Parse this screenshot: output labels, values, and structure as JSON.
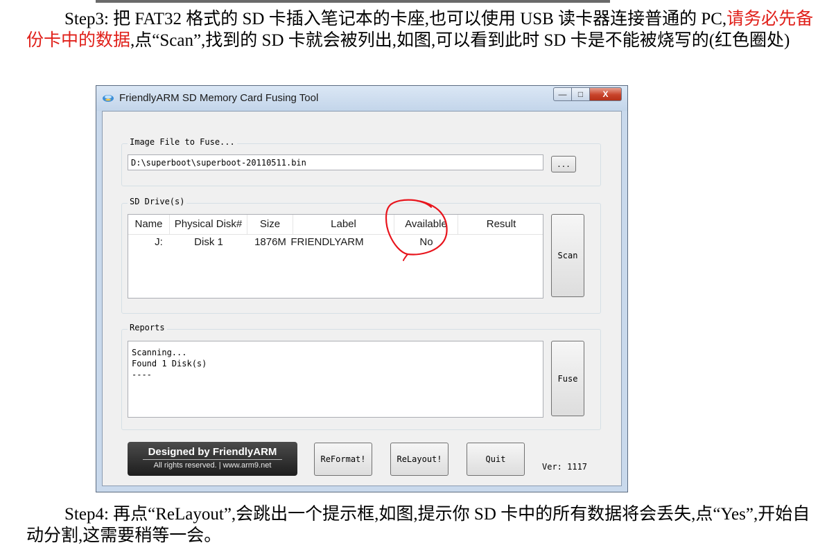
{
  "doc": {
    "step3_prefix": "Step3: 把 FAT32 格式的 SD 卡插入笔记本的卡座,也可以使用 USB 读卡器连接普通的 PC,",
    "step3_warning": "请务必先备份卡中的数据",
    "step3_suffix": ",点“Scan”,找到的 SD 卡就会被列出,如图,可以看到此时 SD 卡是不能被烧写的(红色圈处)",
    "step4": "Step4: 再点“ReLayout”,会跳出一个提示框,如图,提示你 SD 卡中的所有数据将会丢失,点“Yes”,开始自动分割,这需要稍等一会。",
    "warning_color": "#e0201a"
  },
  "window": {
    "title": "FriendlyARM SD Memory Card Fusing Tool",
    "minimize_glyph": "—",
    "maximize_glyph": "□",
    "close_glyph": "X",
    "icon": "app-icon"
  },
  "image_group": {
    "label": "Image File to Fuse...",
    "path": "D:\\superboot\\superboot-20110511.bin",
    "browse_label": "..."
  },
  "drives_group": {
    "label": "SD Drive(s)",
    "columns": [
      "Name",
      "Physical Disk#",
      "Size",
      "Label",
      "Available",
      "Result"
    ],
    "rows": [
      {
        "name": "J:",
        "physical_disk": "Disk 1",
        "size": "1876M",
        "label": "FRIENDLYARM",
        "available": "No",
        "result": ""
      }
    ],
    "scan_label": "Scan",
    "annotation_color": "#e8141c"
  },
  "reports_group": {
    "label": "Reports",
    "lines": [
      "Scanning...",
      "Found 1 Disk(s)",
      "----"
    ],
    "fuse_label": "Fuse"
  },
  "footer": {
    "logo_title": "Designed by FriendlyARM",
    "logo_sub": "All rights reserved. | www.arm9.net",
    "reformat_label": "ReFormat!",
    "relayout_label": "ReLayout!",
    "quit_label": "Quit",
    "version": "Ver: 1117"
  }
}
